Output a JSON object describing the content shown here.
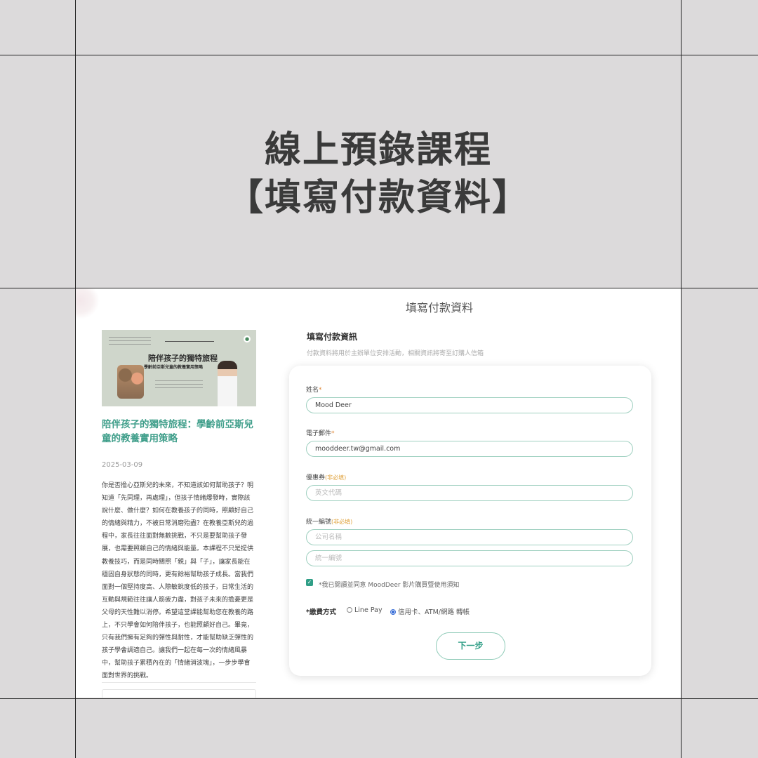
{
  "banner": {
    "line1": "線上預錄課程",
    "line2": "【填寫付款資料】"
  },
  "page": {
    "heading": "填寫付款資料"
  },
  "course": {
    "thumbnail_title": "陪伴孩子的獨特旅程",
    "thumbnail_subtitle": "學齡前亞斯兒童的教養實用策略",
    "title": "陪伴孩子的獨特旅程：學齡前亞斯兒童的教養實用策略",
    "date": "2025-03-09",
    "description": "你是否擔心亞斯兒的未來，不知道該如何幫助孩子？明知道「先同理，再處理」，但孩子情緒爆發時，實際該說什麼、做什麼？如何在教養孩子的同時，照顧好自己的情緒與精力，不被日常消磨殆盡？在教養亞斯兒的過程中，家長往往面對無數挑戰，不只是要幫助孩子發展，也需要照顧自己的情緒與能量。本課程不只是提供教養技巧，而是同時關照「親」與「子」，讓家長能在穩固自身狀態的同時，更有餘裕幫助孩子成長。當我們面對一個堅持度高、人際敏銳度低的孩子，日常生活的互動與規範往往讓人筋疲力盡，對孩子未來的擔憂更是父母的天性難以消停。希望這堂課能幫助您在教養的路上，不只學會如何陪伴孩子，也能照顧好自己。畢竟，只有我們擁有足夠的彈性與耐性，才能幫助缺乏彈性的孩子學會調適自己。讓我們一起在每一次的情緒風暴中，幫助孩子累積內在的「情緒消波塊」，一步步學會面對世界的挑戰。"
  },
  "form": {
    "section_title": "填寫付款資訊",
    "section_note": "付款資料將用於主辦單位安排活動，相關資訊將寄至訂購人信箱",
    "name_label": "姓名",
    "name_value": "Mood Deer",
    "email_label": "電子郵件",
    "email_value": "mooddeer.tw@gmail.com",
    "coupon_label": "優惠券",
    "coupon_optional": "(非必填)",
    "coupon_placeholder": "英文代碼",
    "tax_label": "統一編號",
    "tax_optional": "(非必填)",
    "company_placeholder": "公司名稱",
    "taxid_placeholder": "統一編號",
    "required_mark": "*",
    "agree_text": "*我已閱讀並同意 MoodDeer 影片購買暨使用須知",
    "agree_checked": true,
    "payment_label": "*繳費方式",
    "payment_options": [
      "Line Pay",
      "信用卡、ATM/網路 轉帳"
    ],
    "payment_selected": "信用卡、ATM/網路 轉帳",
    "next_button": "下一步"
  },
  "colors": {
    "accent": "#2f9e86",
    "field_border": "#9fd0c0",
    "optional_tag": "#e0a23c",
    "background": "#dcdadb"
  },
  "icons": {
    "checkbox": "check-icon",
    "radio_off": "radio-unselected-icon",
    "radio_on": "radio-selected-icon"
  }
}
